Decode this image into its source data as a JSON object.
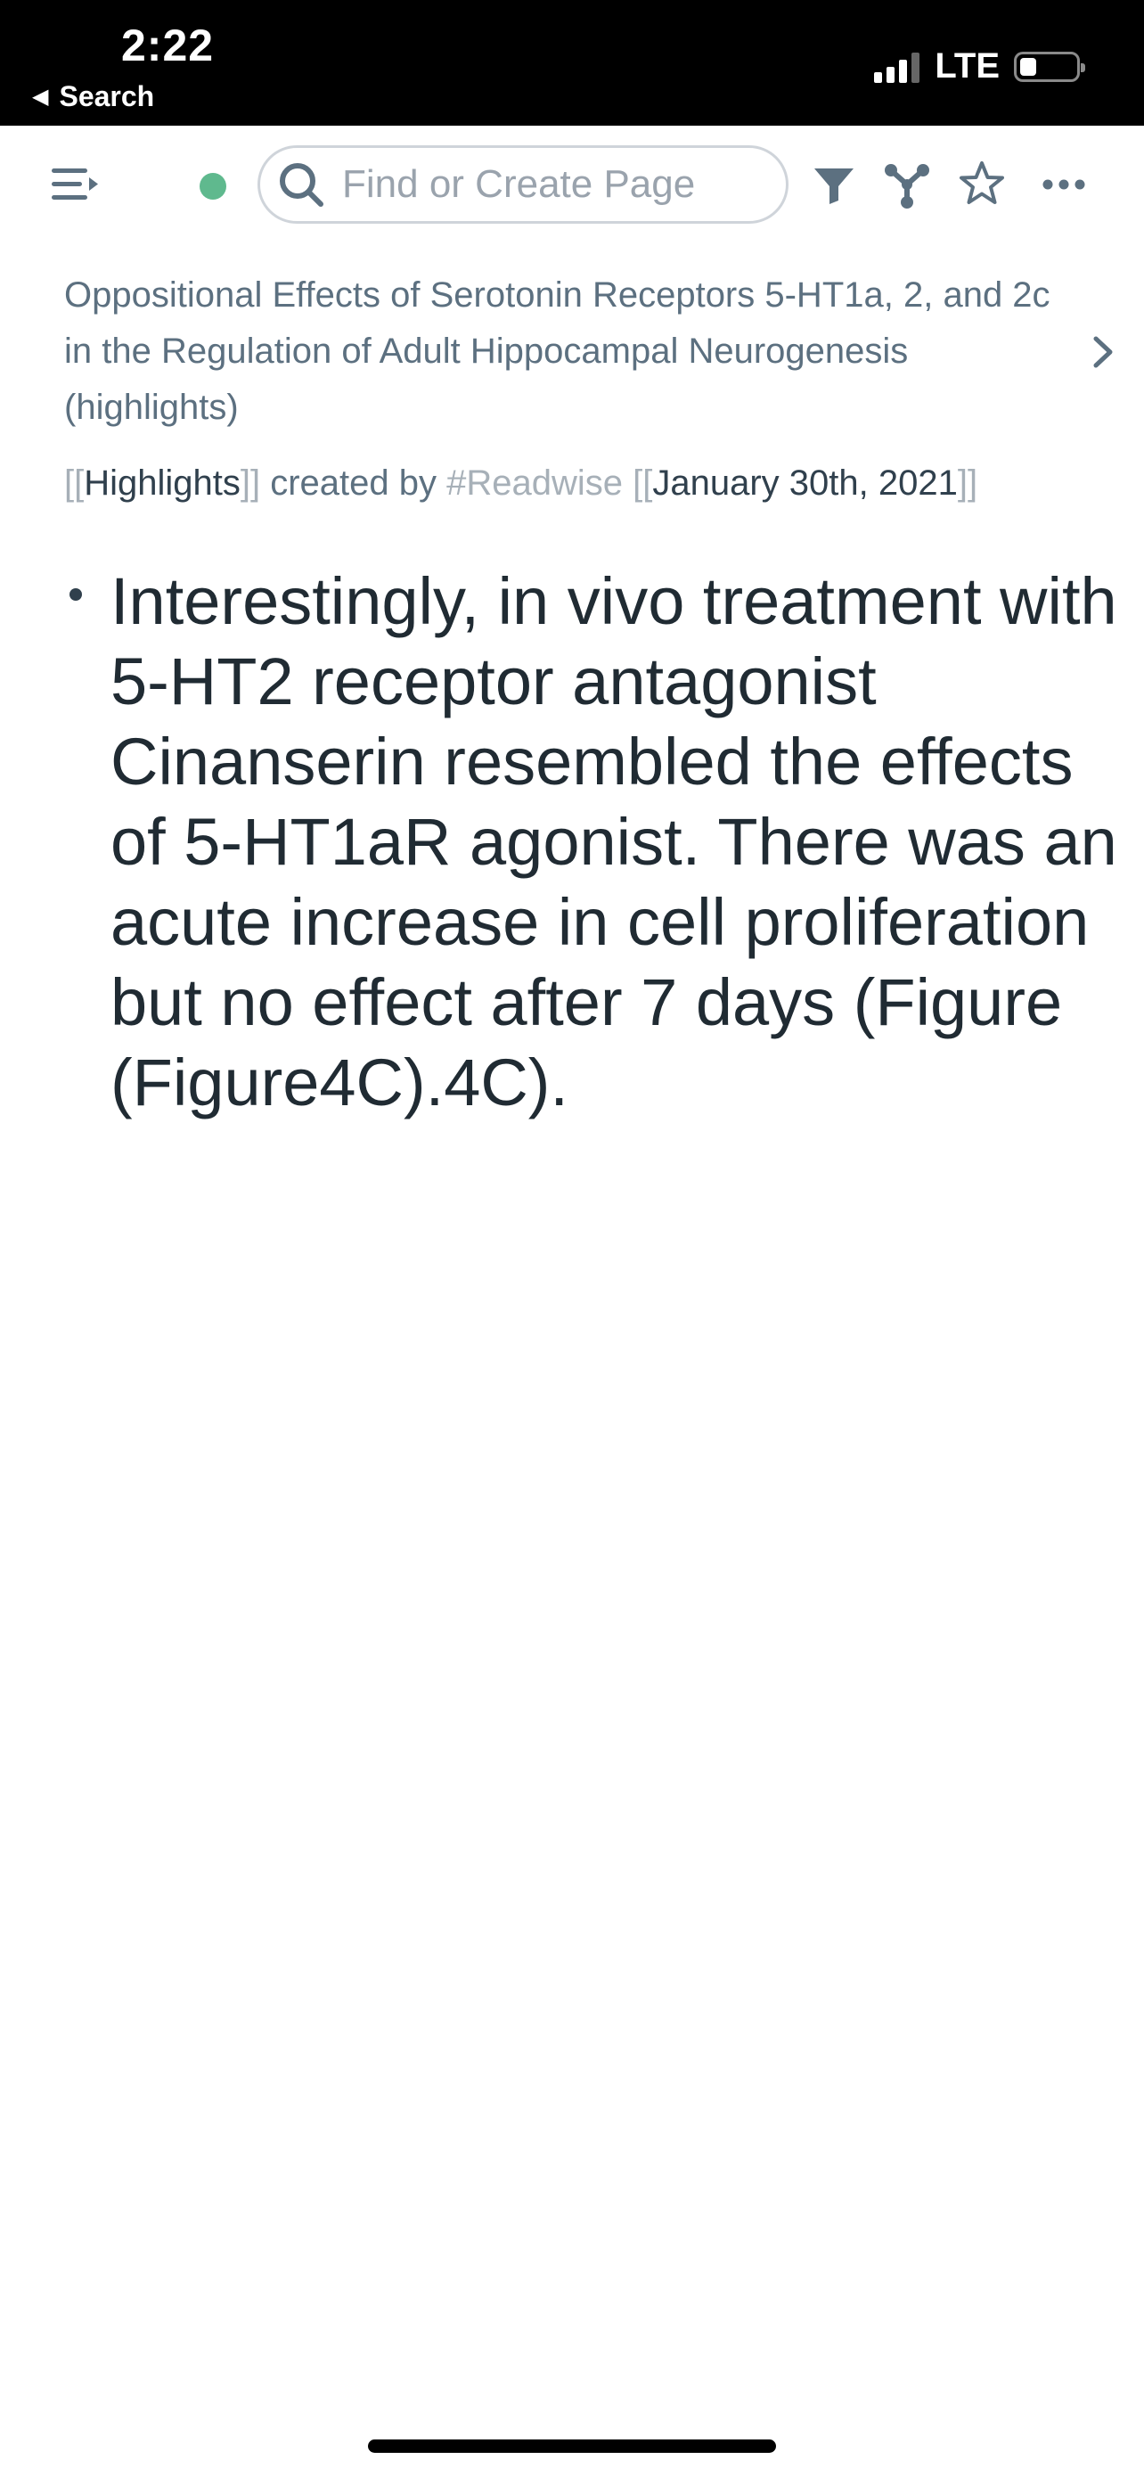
{
  "status_bar": {
    "time": "2:22",
    "back_label": "Search",
    "network": "LTE",
    "signal_bars_active": 3,
    "signal_bars_total": 4,
    "battery_level": 0.3
  },
  "toolbar": {
    "search_placeholder": "Find or Create Page",
    "sync_status_color": "#5fb98e",
    "icons": [
      "menu-icon",
      "search-icon",
      "filter-icon",
      "graph-icon",
      "star-icon",
      "more-icon"
    ]
  },
  "page": {
    "breadcrumb": "Oppositional Effects of Serotonin Receptors 5-HT1a, 2, and 2c in the Regulation of Adult Hippocampal Neurogenesis (highlights)",
    "meta": {
      "open_bracket": "[[",
      "highlights_link": "Highlights",
      "close_bracket": "]]",
      "created_by": " created by ",
      "tag": "#Readwise",
      "date_open_bracket": " [[",
      "date_link": "January 30th, 2021",
      "date_close_bracket": "]]"
    },
    "blocks": [
      {
        "text": "Interestingly, in vivo treatment with 5-HT2 receptor antagonist Cinanserin resembled the effects of 5-HT1aR agonist. There was an acute increase in cell proliferation but no effect after 7 days (Figure (Figure4C).4C)."
      }
    ]
  }
}
